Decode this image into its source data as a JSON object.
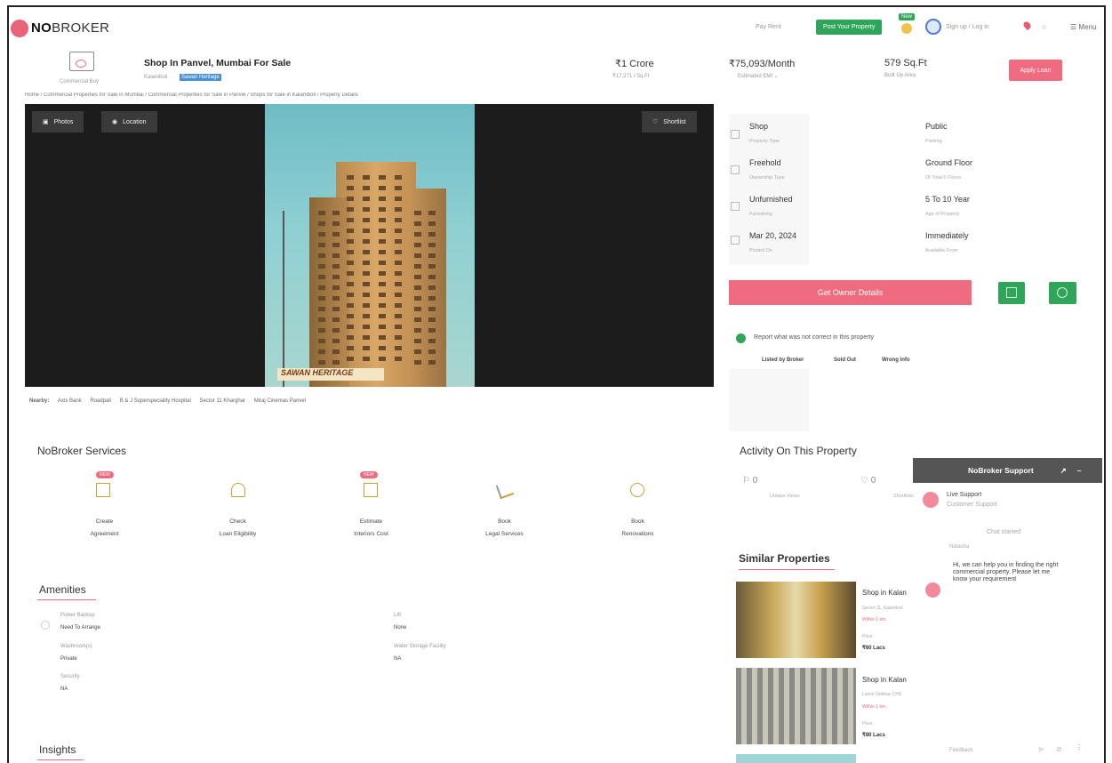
{
  "header": {
    "brand_no": "NO",
    "brand_rest": "BROKER",
    "pay_rent": "Pay Rent",
    "post_property": "Post Your Property",
    "new_badge": "New",
    "sign_in": "Sign up / Log in",
    "menu": "Menu"
  },
  "listing": {
    "category_label": "Commercial Buy",
    "title": "Shop In Panvel, Mumbai For Sale",
    "locality": "Kalamboli",
    "society": "Sawan Heritage",
    "price": "₹1 Crore",
    "price_sub": "₹17,271 / Sq.Ft",
    "emi": "₹75,093/Month",
    "emi_sub": "Estimated EMI",
    "area": "579 Sq.Ft",
    "area_sub": "Built Up Area",
    "apply_loan": "Apply Loan"
  },
  "breadcrumb": "Home / Commercial Properties for Sale in Mumbai / Commercial Properties for Sale in Panvel / Shops for Sale in Kalamboli / Property Details",
  "gallery": {
    "photos": "Photos",
    "location": "Location",
    "shortlist": "Shortlist",
    "sign_text": "SAWAN HERITAGE"
  },
  "nearby": {
    "label": "Nearby:",
    "items": [
      "Axis Bank",
      "Roadpali",
      "B & J Superspeciality Hospital",
      "Sector 11 Kharghar",
      "Miraj Cinemas Panvel"
    ]
  },
  "details": [
    {
      "value": "Shop",
      "key": "Property Type"
    },
    {
      "value": "Public",
      "key": "Parking"
    },
    {
      "value": "Freehold",
      "key": "Ownership Type"
    },
    {
      "value": "Ground Floor",
      "key": "Of Total 5 Floors"
    },
    {
      "value": "Unfurnished",
      "key": "Furnishing"
    },
    {
      "value": "5 To 10 Year",
      "key": "Age of Property"
    },
    {
      "value": "Mar 20, 2024",
      "key": "Posted On"
    },
    {
      "value": "Immediately",
      "key": "Available From"
    }
  ],
  "owner_btn": "Get Owner Details",
  "report": {
    "text": "Report what was not correct in this property",
    "links": [
      "Listed by Broker",
      "Sold Out",
      "Wrong Info"
    ]
  },
  "activity": {
    "title": "Activity On This Property",
    "views": "0",
    "views_label": "Unique Views",
    "shortlists": "0",
    "shortlists_label": "Shortlists"
  },
  "services": {
    "title": "NoBroker Services",
    "new_tag": "NEW",
    "items": [
      {
        "line1": "Create",
        "line2": "Agreement"
      },
      {
        "line1": "Check",
        "line2": "Loan Eligibility"
      },
      {
        "line1": "Estimate",
        "line2": "Interiors Cost"
      },
      {
        "line1": "Book",
        "line2": "Legal Services"
      },
      {
        "line1": "Book",
        "line2": "Renovations"
      }
    ]
  },
  "amenities": {
    "title": "Amenities",
    "items": [
      {
        "key": "Power Backup",
        "value": "Need To Arrange"
      },
      {
        "key": "Lift",
        "value": "None"
      },
      {
        "key": "Washroom(s)",
        "value": "Private"
      },
      {
        "key": "Water Storage Facility",
        "value": "NA"
      },
      {
        "key": "Security",
        "value": "NA"
      }
    ]
  },
  "insights": "Insights",
  "support": {
    "title": "NoBroker Support",
    "live": "Live Support",
    "live_sub": "Customer Support",
    "chat_started": "Chat started",
    "agent": "Natasha",
    "message": "Hi, we can help you in finding the right commercial property. Please let me know your requirement",
    "footer": "Feedback"
  },
  "similar": {
    "title": "Similar Properties",
    "items": [
      {
        "title": "Shop in Kalan",
        "sub": "Sector 11, Kalamboli",
        "tag": "Within 1 km",
        "price_label": "Price",
        "price": "₹60 Lacs"
      },
      {
        "title": "Shop in Kalan",
        "sub": "Laxmi Vaibhav CHS",
        "tag": "Within 1 km",
        "price_label": "Price",
        "price": "₹80 Lacs"
      }
    ]
  }
}
